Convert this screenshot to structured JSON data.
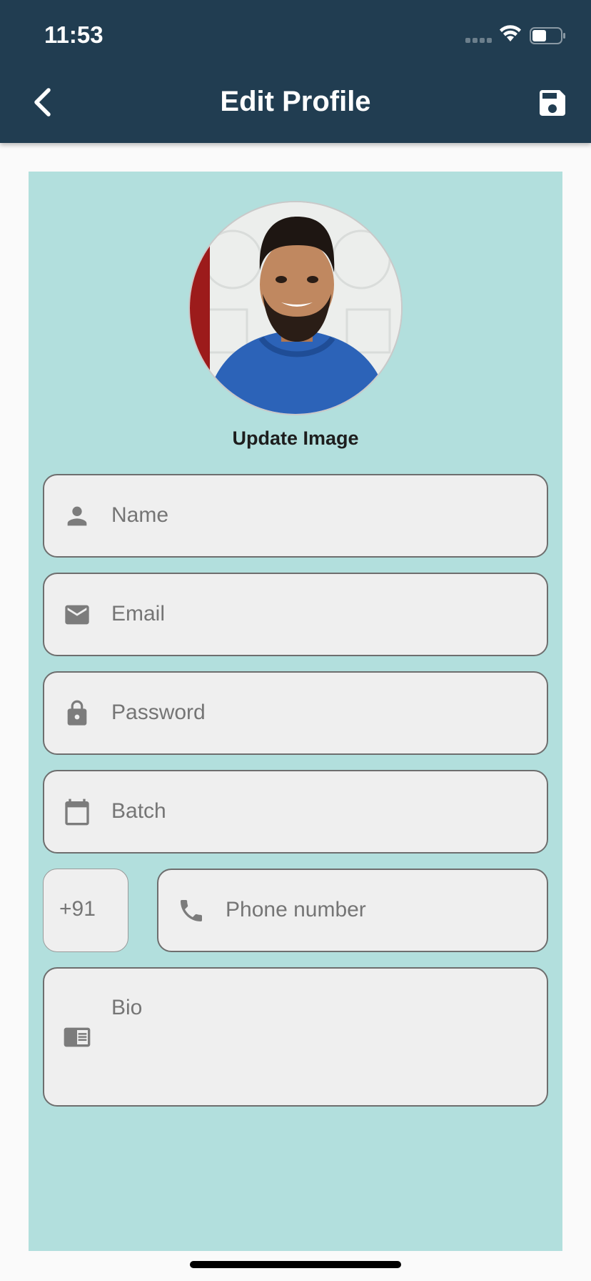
{
  "status_bar": {
    "time": "11:53"
  },
  "header": {
    "title": "Edit Profile",
    "background": "#213d51",
    "back_icon": "chevron-left-icon",
    "save_icon": "save-icon"
  },
  "card": {
    "background": "#b2dfdd"
  },
  "avatar": {
    "update_label": "Update Image"
  },
  "form": {
    "name": {
      "placeholder": "Name",
      "icon": "person-icon"
    },
    "email": {
      "placeholder": "Email",
      "icon": "mail-icon"
    },
    "password": {
      "placeholder": "Password",
      "icon": "lock-icon"
    },
    "batch": {
      "placeholder": "Batch",
      "icon": "calendar-icon"
    },
    "country_code": {
      "value": "+91"
    },
    "phone": {
      "placeholder": "Phone number",
      "icon": "phone-icon"
    },
    "bio": {
      "placeholder": "Bio",
      "icon": "article-icon"
    }
  }
}
